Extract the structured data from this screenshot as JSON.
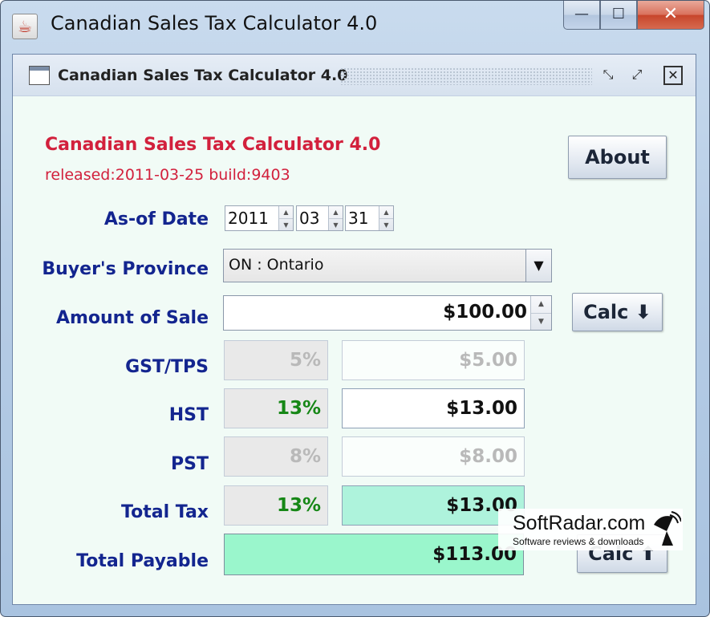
{
  "window": {
    "title": "Canadian Sales Tax Calculator 4.0",
    "controls": {
      "minimize": "—",
      "maximize": "☐",
      "close": "✕"
    }
  },
  "internal_frame": {
    "title": "Canadian Sales Tax Calculator 4.0",
    "controls": {
      "iconify": "⤡",
      "maximize": "⤢",
      "close": "✕"
    }
  },
  "header": {
    "app_name": "Canadian Sales Tax Calculator 4.0",
    "release": "released:2011-03-25 build:9403",
    "about_button": "About"
  },
  "as_of_date": {
    "label": "As-of Date",
    "year": "2011",
    "month": "03",
    "day": "31"
  },
  "province": {
    "label": "Buyer's Province",
    "selected": "ON : Ontario"
  },
  "amount": {
    "label": "Amount of Sale",
    "value": "$100.00",
    "calc_down_button": "Calc ⬇"
  },
  "taxes": {
    "gst": {
      "label": "GST/TPS",
      "rate": "5%",
      "amount": "$5.00"
    },
    "hst": {
      "label": "HST",
      "rate": "13%",
      "amount": "$13.00"
    },
    "pst": {
      "label": "PST",
      "rate": "8%",
      "amount": "$8.00"
    },
    "total": {
      "label": "Total Tax",
      "rate": "13%",
      "amount": "$13.00"
    }
  },
  "payable": {
    "label": "Total Payable",
    "value": "$113.00",
    "calc_up_button": "Calc ⬆"
  },
  "watermark": {
    "name": "SoftRadar.com",
    "tagline": "Software reviews & downloads"
  },
  "colors": {
    "heading_red": "#d2203c",
    "label_blue": "#13258f",
    "rate_green": "#168716",
    "total_tax_bg": "#aef3dc",
    "payable_bg": "#9af6cc"
  }
}
